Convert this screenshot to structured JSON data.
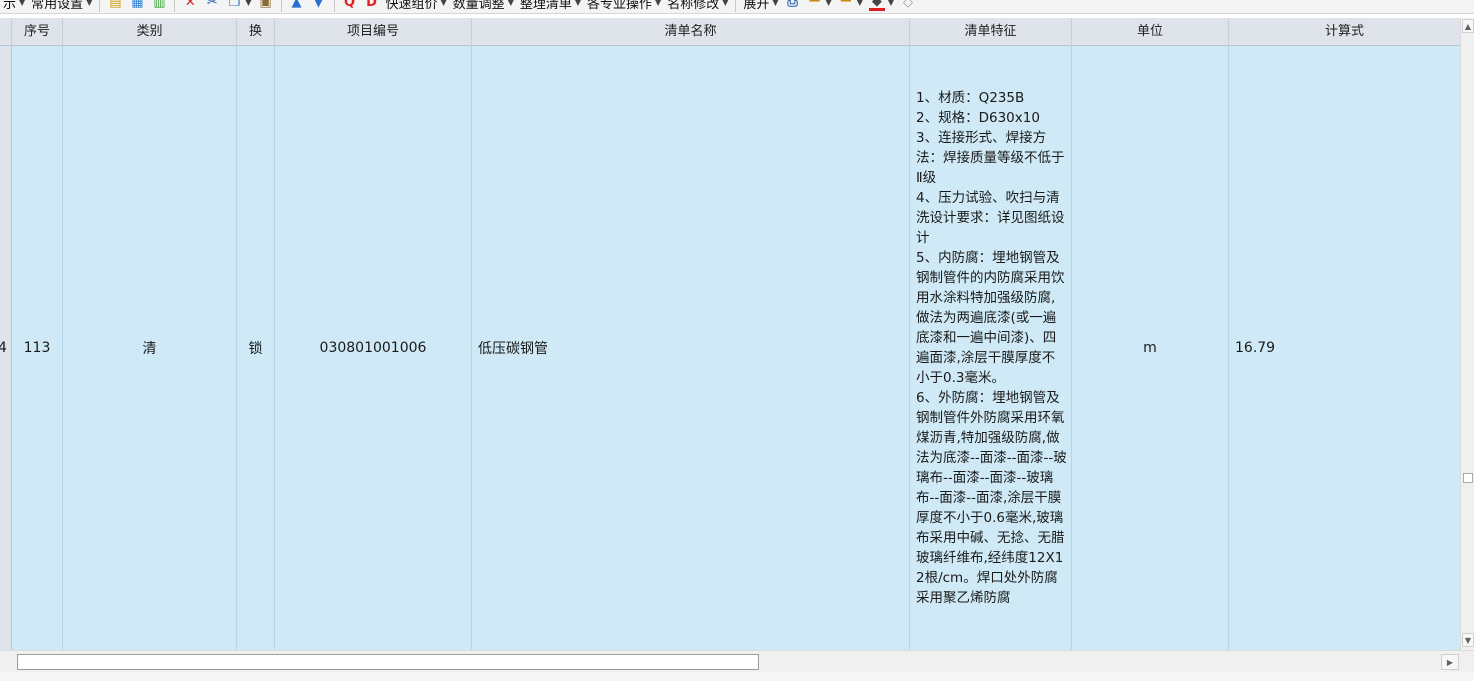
{
  "toolbar": {
    "items": [
      {
        "label": "示"
      },
      {
        "label": "常用设置"
      },
      {
        "label": "快速组价"
      },
      {
        "label": "数量调整"
      },
      {
        "label": "整理清单"
      },
      {
        "label": "各专业操作"
      },
      {
        "label": "名称修改"
      },
      {
        "label": "展开"
      }
    ],
    "icons": [
      "insert-row-icon",
      "insert-child-icon",
      "add-item-icon",
      "delete-icon",
      "cut-icon",
      "copy-icon",
      "paste-icon",
      "move-up-icon",
      "move-down-icon",
      "query-icon",
      "apply-icon",
      "print-icon",
      "lock-icon",
      "unlock-icon",
      "fill-color-icon",
      "eraser-icon"
    ],
    "colors": {
      "delete": "#e02020",
      "fill_underline": "#e02020"
    }
  },
  "columns": {
    "seq": "序号",
    "category": "类别",
    "swap": "换",
    "code": "项目编号",
    "name": "清单名称",
    "feature": "清单特征",
    "unit": "单位",
    "formula": "计算式"
  },
  "row": {
    "row_header": "4",
    "seq": "113",
    "category": "清",
    "swap": "锁",
    "code": "030801001006",
    "name": "低压碳钢管",
    "feature": "1、材质：Q235B\n2、规格：D630x10\n3、连接形式、焊接方法：焊接质量等级不低于Ⅱ级\n4、压力试验、吹扫与清洗设计要求：详见图纸设计\n5、内防腐：埋地钢管及钢制管件的内防腐采用饮用水涂料特加强级防腐,做法为两遍底漆(或一遍底漆和一遍中间漆)、四遍面漆,涂层干膜厚度不小于0.3毫米。\n6、外防腐：埋地钢管及钢制管件外防腐采用环氧煤沥青,特加强级防腐,做法为底漆--面漆--面漆--玻璃布--面漆--面漆--玻璃布--面漆--面漆,涂层干膜厚度不小于0.6毫米,玻璃布采用中碱、无捻、无腊玻璃纤维布,经纬度12X12根/cm。焊口处外防腐采用聚乙烯防腐",
    "unit": "m",
    "formula": "16.79"
  },
  "colors": {
    "row_selected_bg": "#cfeaf6",
    "header_bg": "#dfe3ea"
  }
}
